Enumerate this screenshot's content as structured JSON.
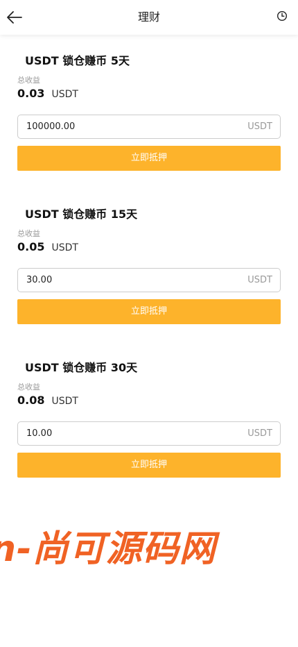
{
  "header": {
    "title": "理财",
    "back_icon": "arrow-left-icon",
    "history_icon": "clock-icon"
  },
  "colors": {
    "accent": "#fdb32b",
    "watermark": "#f06224",
    "muted_text": "#999999"
  },
  "products": [
    {
      "title": "USDT 锁仓赚币 5天",
      "earnings_label": "总收益",
      "earnings_value": "0.03",
      "earnings_unit": "USDT",
      "amount_value": "100000.00",
      "amount_unit": "USDT",
      "button_label": "立即抵押"
    },
    {
      "title": "USDT 锁仓赚币 15天",
      "earnings_label": "总收益",
      "earnings_value": "0.05",
      "earnings_unit": "USDT",
      "amount_value": "30.00",
      "amount_unit": "USDT",
      "button_label": "立即抵押"
    },
    {
      "title": "USDT 锁仓赚币 30天",
      "earnings_label": "总收益",
      "earnings_value": "0.08",
      "earnings_unit": "USDT",
      "amount_value": "10.00",
      "amount_unit": "USDT",
      "button_label": "立即抵押"
    }
  ],
  "watermark": {
    "text": "n-尚可源码网"
  }
}
